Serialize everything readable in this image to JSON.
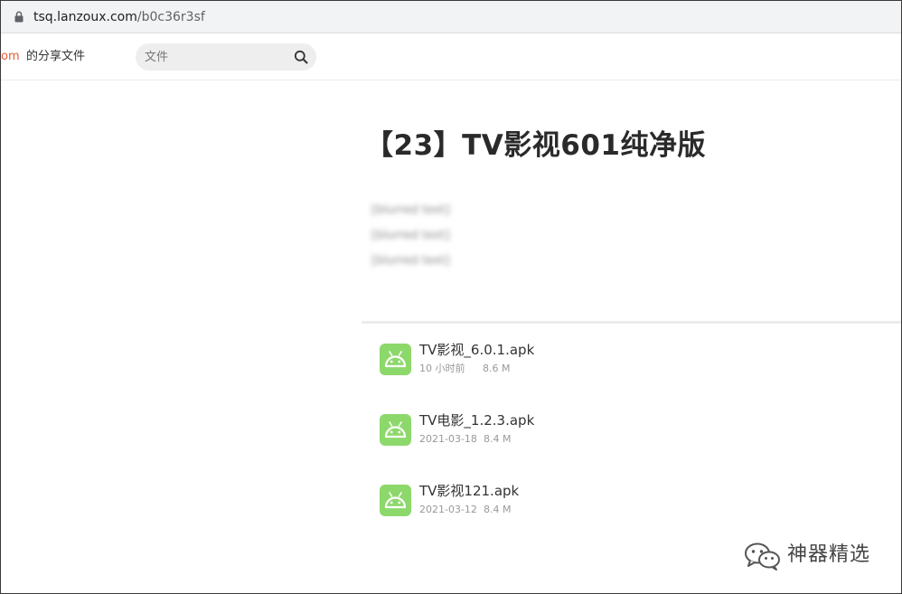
{
  "browser": {
    "url_host": "tsq.lanzoux.com",
    "url_path": "/b0c36r3sf"
  },
  "header": {
    "logo_tail": "om",
    "share_label": "的分享文件",
    "search_placeholder": "文件",
    "search_value": ""
  },
  "page": {
    "title": "【23】TV影视601纯净版",
    "description_lines": [
      "[blurred text]",
      "[blurred text]",
      "[blurred text]"
    ]
  },
  "files": [
    {
      "name": "TV影视_6.0.1.apk",
      "date": "10 小时前",
      "size": "8.6 M"
    },
    {
      "name": "TV电影_1.2.3.apk",
      "date": "2021-03-18",
      "size": "8.4 M"
    },
    {
      "name": "TV影视121.apk",
      "date": "2021-03-12",
      "size": "8.4 M"
    }
  ],
  "watermark": {
    "text": "神器精选",
    "icon": "wechat-icon"
  },
  "colors": {
    "accent": "#e45b35",
    "android_green": "#8dd86b"
  }
}
